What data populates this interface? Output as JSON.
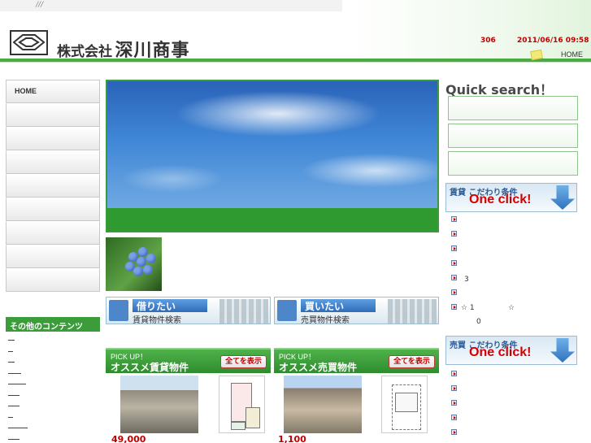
{
  "header": {
    "slashes": "///",
    "company_prefix": "株式会社",
    "company_name": "深川商事",
    "counter": "306",
    "datetime": "2011/06/16 09:58",
    "home_link": "HOME"
  },
  "nav": {
    "items": [
      {
        "label": "HOME"
      },
      {
        "label": ""
      },
      {
        "label": ""
      },
      {
        "label": ""
      },
      {
        "label": ""
      },
      {
        "label": ""
      },
      {
        "label": ""
      },
      {
        "label": ""
      },
      {
        "label": ""
      },
      {
        "label": ""
      }
    ],
    "other_heading": "その他のコンテンツ"
  },
  "search_buttons": {
    "rent": {
      "title": "借りたい",
      "subtitle": "賃貸物件検索"
    },
    "buy": {
      "title": "買いたい",
      "subtitle": "売買物件検索"
    }
  },
  "pickup": {
    "rent": {
      "label": "PICK UP！",
      "title": "オススメ賃貸物件",
      "button": "全てを表示",
      "price": "49,000"
    },
    "buy": {
      "label": "PICK UP！",
      "title": "オススメ売買物件",
      "button": "全てを表示",
      "price": "1,100"
    }
  },
  "quick_search": {
    "title": "Quick search！"
  },
  "oneclick": {
    "rent": {
      "label": "賃貸 こだわり条件",
      "big": "One click!"
    },
    "sale": {
      "label": "売買 こだわり条件",
      "big": "One click!"
    }
  },
  "right_list": {
    "count_a": "3",
    "star_a": "☆ 1",
    "star_b": "☆",
    "count_b": "0"
  },
  "colors": {
    "accent_green": "#4bab43",
    "date_red": "#c00000",
    "oneclick_red": "#d40000"
  }
}
